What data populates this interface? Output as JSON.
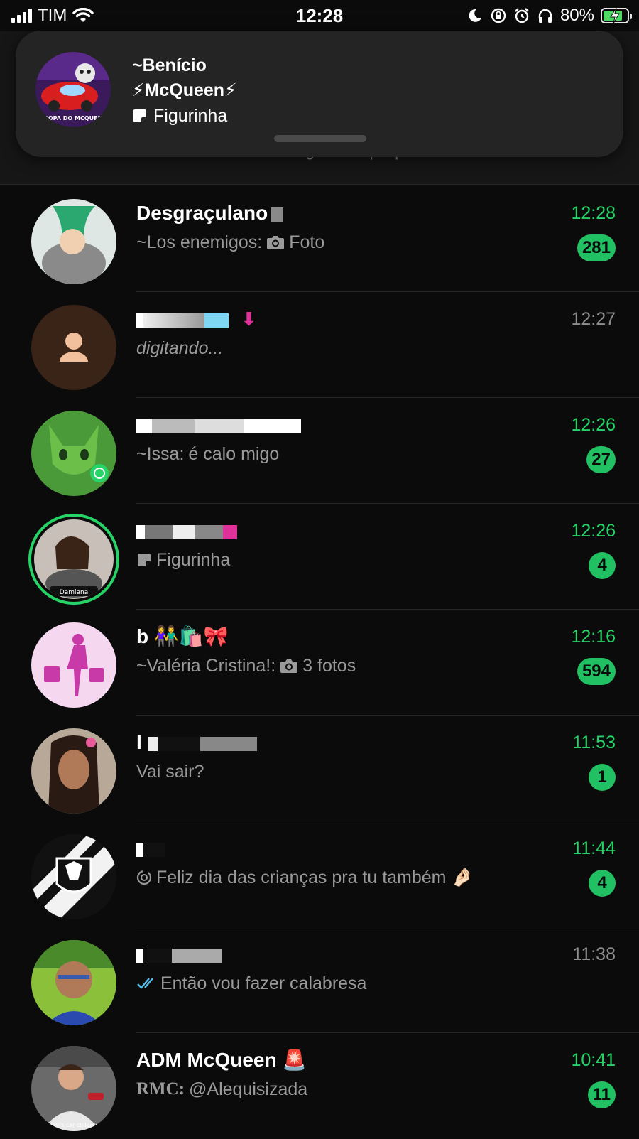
{
  "status_bar": {
    "carrier": "TIM",
    "time": "12:28",
    "battery": "80%",
    "battery_level": 0.8
  },
  "background_notice": "recebe novas mensagens. Toque para mudar.",
  "notification": {
    "sender": "~Benício",
    "group": "⚡McQueen⚡",
    "message": "Figurinha",
    "avatar_caption": "TROPA DO MCQUEEN"
  },
  "chats": [
    {
      "name": "Desgraçulano",
      "sender": "~Los enemigos:",
      "preview": "Foto",
      "preview_icon": "camera-icon",
      "time": "12:28",
      "unread": "281"
    },
    {
      "name": "",
      "sender": "",
      "preview": "digitando...",
      "time": "12:27",
      "unread": ""
    },
    {
      "name": "",
      "sender": "~Issa:",
      "preview": "é calo migo",
      "time": "12:26",
      "unread": "27"
    },
    {
      "name": "",
      "sender": "",
      "preview": "Figurinha",
      "preview_icon": "sticker-icon",
      "time": "12:26",
      "unread": "4",
      "avatar_caption": "Damiana"
    },
    {
      "name": "b 👫🛍️🎀",
      "sender": "~Valéria Cristina!:",
      "preview": "3 fotos",
      "preview_icon": "camera-icon",
      "time": "12:16",
      "unread": "594"
    },
    {
      "name": "I",
      "sender": "",
      "preview": "Vai sair?",
      "time": "11:53",
      "unread": "1"
    },
    {
      "name": "",
      "sender": "",
      "preview": "Feliz dia das crianças pra tu também 🤌🏻",
      "preview_icon": "view-once-icon",
      "time": "11:44",
      "unread": "4"
    },
    {
      "name": "",
      "sender": "",
      "preview": "Então vou fazer calabresa",
      "preview_icon": "double-check-icon",
      "time": "11:38",
      "unread": ""
    },
    {
      "name": "ADM McQueen 🚨",
      "sender": "RMC:",
      "preview": "@Alequisizada",
      "time": "10:41",
      "unread": "11",
      "avatar_caption": "Messi's car collection"
    }
  ],
  "colors": {
    "accent": "#25d366",
    "badge": "#21c063",
    "background": "#0b0b0b",
    "banner": "#242424"
  }
}
